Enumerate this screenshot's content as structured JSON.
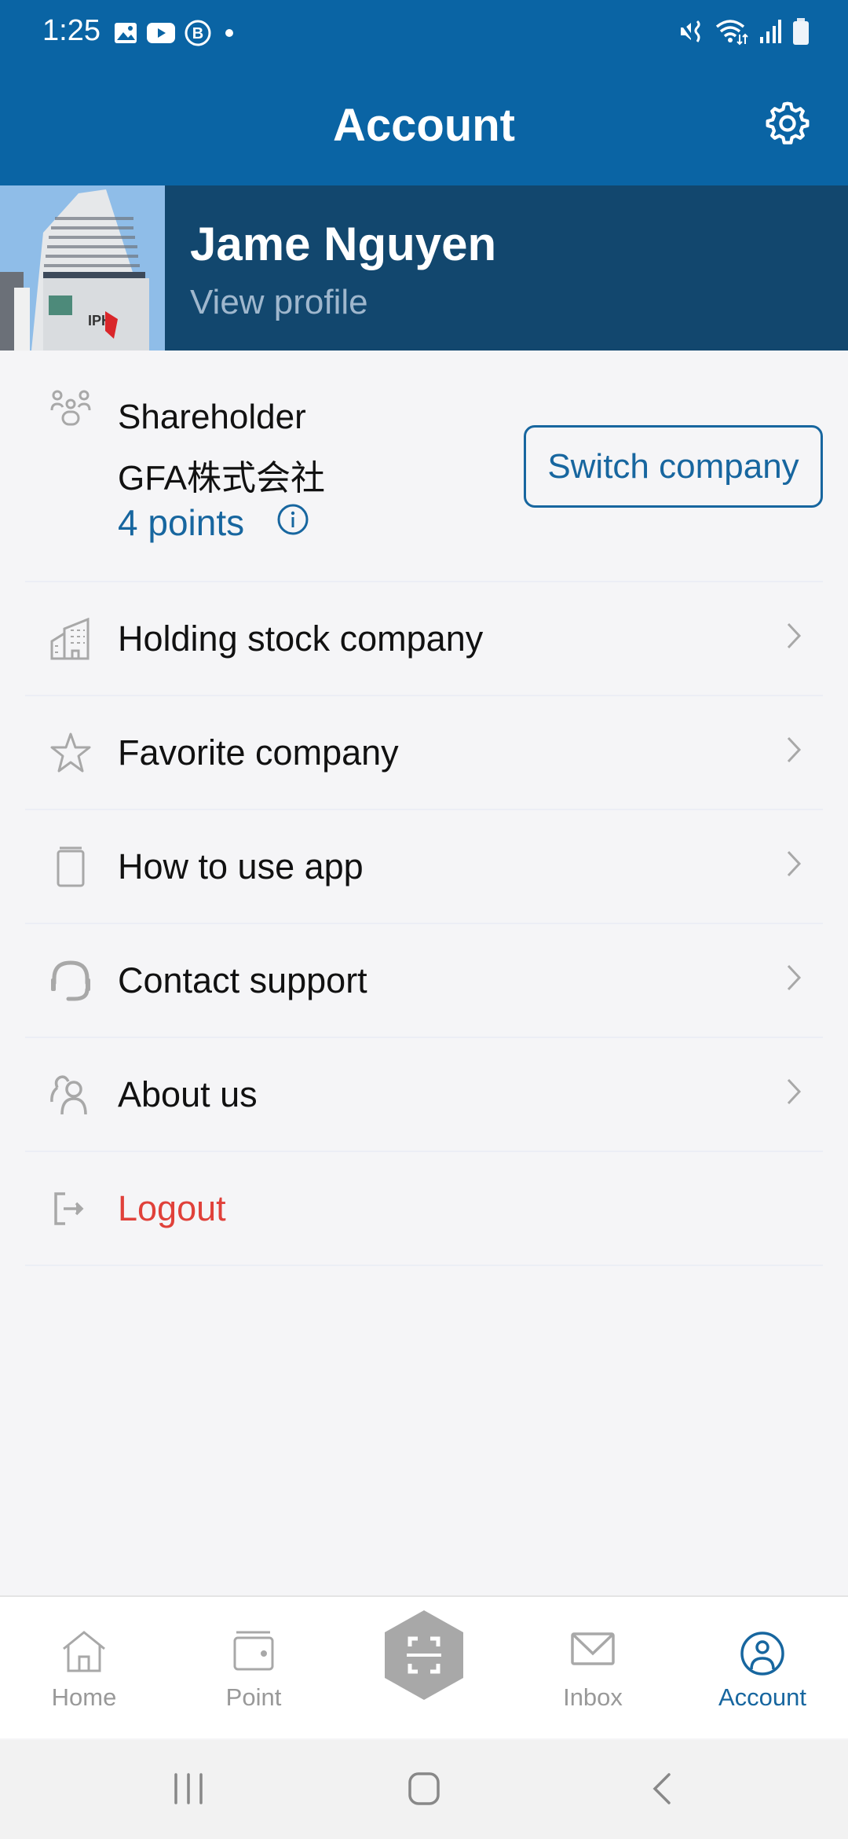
{
  "status_bar": {
    "time": "1:25",
    "left_icons": [
      "gallery-icon",
      "youtube-icon",
      "b-circle-icon",
      "dot-icon"
    ],
    "right_icons": [
      "vibrate-mute-icon",
      "wifi-icon",
      "signal-icon",
      "battery-icon"
    ]
  },
  "header": {
    "title": "Account",
    "settings_icon": "gear-icon"
  },
  "profile": {
    "name": "Jame Nguyen",
    "link_label": "View profile"
  },
  "shareholder": {
    "role": "Shareholder",
    "company": "GFA株式会社",
    "points": "4 points",
    "switch_label": "Switch company"
  },
  "menu": [
    {
      "label": "Holding stock company",
      "icon": "building-icon",
      "chevron": true
    },
    {
      "label": "Favorite company",
      "icon": "star-icon",
      "chevron": true
    },
    {
      "label": "How to use app",
      "icon": "book-icon",
      "chevron": true
    },
    {
      "label": "Contact support",
      "icon": "headset-icon",
      "chevron": true
    },
    {
      "label": "About us",
      "icon": "users-icon",
      "chevron": true
    },
    {
      "label": "Logout",
      "icon": "logout-icon",
      "chevron": false
    }
  ],
  "bottom_nav": {
    "items": [
      {
        "label": "Home",
        "icon": "home-icon",
        "active": false
      },
      {
        "label": "Point",
        "icon": "wallet-icon",
        "active": false
      },
      {
        "label": "",
        "icon": "scan-icon",
        "active": false
      },
      {
        "label": "Inbox",
        "icon": "mail-icon",
        "active": false
      },
      {
        "label": "Account",
        "icon": "account-circle-icon",
        "active": true
      }
    ]
  },
  "colors": {
    "primary": "#0a64a4",
    "banner": "#12476e",
    "accent": "#17669f",
    "danger": "#e0413a",
    "icon_gray": "#a8a8a8"
  }
}
